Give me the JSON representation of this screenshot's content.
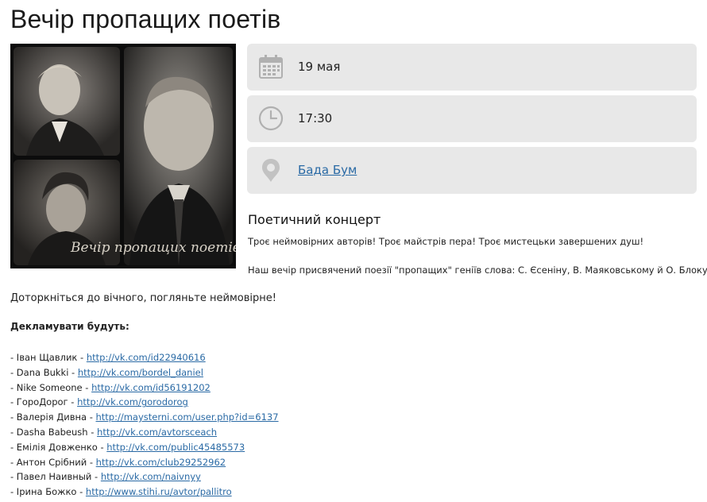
{
  "event": {
    "title": "Вечір пропащих поетів",
    "poster": {
      "caption": "Вечір пропащих поетів"
    },
    "date": {
      "icon": "calendar-icon",
      "value": "19 мая"
    },
    "time": {
      "icon": "clock-icon",
      "value": "17:30"
    },
    "venue": {
      "icon": "map-pin-icon",
      "value": "Бада Бум"
    },
    "concert_title": "Поетичний концерт",
    "description": [
      "Троє неймовірних авторів! Троє майстрів пера! Троє мистецьки завершених душ!",
      "Наш вечір присвячений поезії \"пропащих\" геніїв слова: С. Єсеніну, В. Маяковському й О. Блоку."
    ],
    "call_to_action": "Доторкніться до вічного, погляньте неймовірне!",
    "performers_heading": "Декламувати будуть:",
    "performers": [
      {
        "prefix": "- Іван Щавлик - ",
        "link": "http://vk.com/id22940616"
      },
      {
        "prefix": "- Dana Bukki - ",
        "link": "http://vk.com/bordel_daniel"
      },
      {
        "prefix": "- Nike Someone - ",
        "link": "http://vk.com/id56191202"
      },
      {
        "prefix": "- ГороДорог - ",
        "link": "http://vk.com/gorodorog"
      },
      {
        "prefix": "- Валерія Дивна - ",
        "link": "http://maysterni.com/user.php?id=6137"
      },
      {
        "prefix": "- Dasha Babeush - ",
        "link": "http://vk.com/avtorsceach"
      },
      {
        "prefix": "- Емілія Довженко - ",
        "link": "http://vk.com/public45485573"
      },
      {
        "prefix": "- Антон Срібний - ",
        "link": "http://vk.com/club29252962"
      },
      {
        "prefix": "- Павел Наивный - ",
        "link": "http://vk.com/naivnyy"
      },
      {
        "prefix": "- Ірина Божко - ",
        "link": "http://www.stihi.ru/avtor/pallitro"
      }
    ]
  },
  "colors": {
    "info_box_bg": "#e8e8e8",
    "link": "#2a6aa5",
    "icon": "#b0b0b0"
  }
}
